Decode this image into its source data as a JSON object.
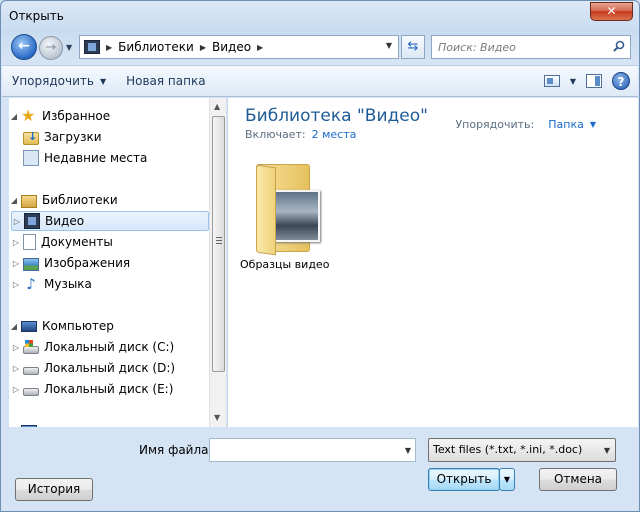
{
  "window": {
    "title": "Открыть",
    "close_label": "✕"
  },
  "address": {
    "crumbs": [
      "Библиотеки",
      "Видео"
    ],
    "search_placeholder": "Поиск: Видео"
  },
  "toolbar": {
    "organize_label": "Упорядочить",
    "new_folder_label": "Новая папка"
  },
  "nav": {
    "favorites_label": "Избранное",
    "downloads_label": "Загрузки",
    "recent_label": "Недавние места",
    "libraries_label": "Библиотеки",
    "video_label": "Видео",
    "documents_label": "Документы",
    "images_label": "Изображения",
    "music_label": "Музыка",
    "computer_label": "Компьютер",
    "disk_c_label": "Локальный диск (C:)",
    "disk_d_label": "Локальный диск (D:)",
    "disk_e_label": "Локальный диск (E:)"
  },
  "content": {
    "title": "Библиотека \"Видео\"",
    "includes_label": "Включает:",
    "includes_link": "2 места",
    "arrange_label": "Упорядочить:",
    "arrange_value": "Папка",
    "items": [
      {
        "name": "Образцы видео"
      }
    ]
  },
  "footer": {
    "filename_label": "Имя файла:",
    "filename_value": "",
    "filter_value": "Text files (*.txt, *.ini, *.doc)",
    "open_label": "Открыть",
    "cancel_label": "Отмена",
    "history_label": "История"
  }
}
